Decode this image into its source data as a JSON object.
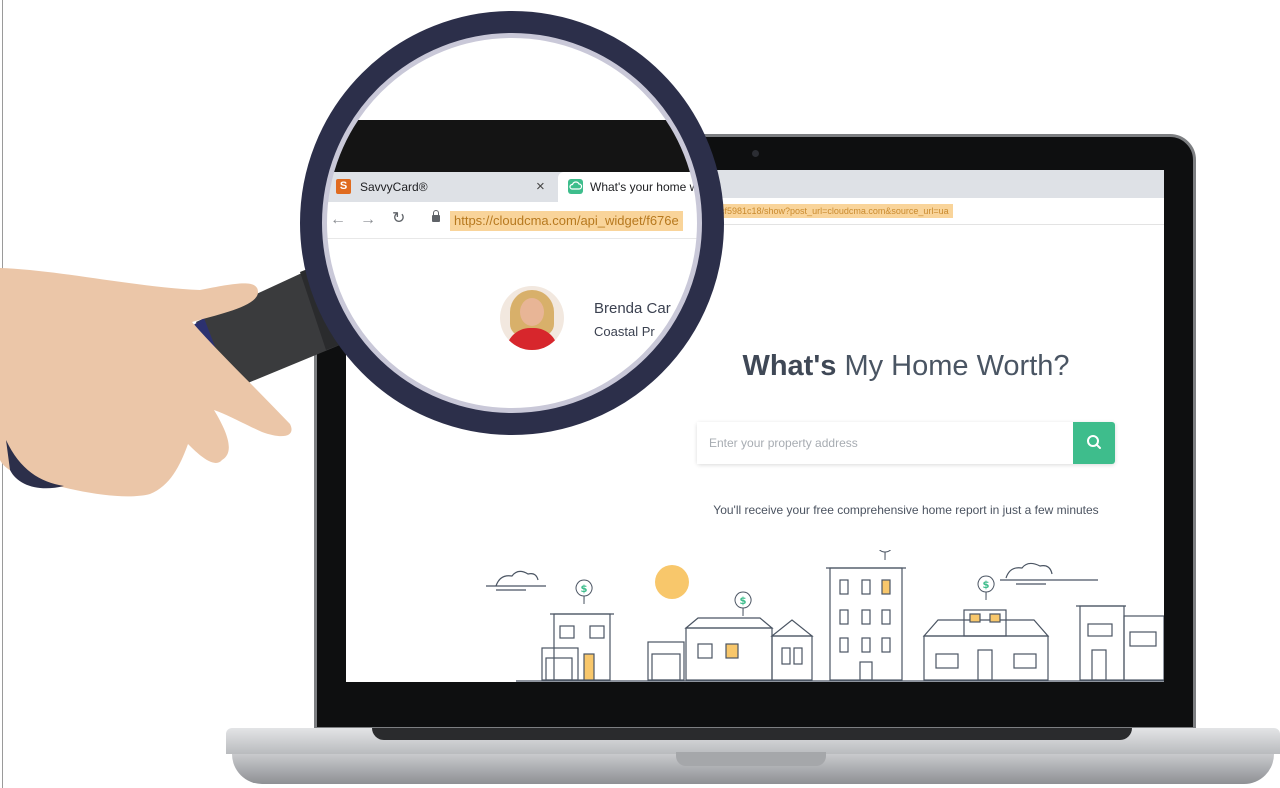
{
  "browser": {
    "tabs": [
      {
        "title": "SavvyCard®",
        "favicon_letter": "S",
        "favicon_color": "#e06b1f"
      },
      {
        "title": "What's your home w",
        "favicon_color": "#3ebd8c"
      }
    ],
    "url_prefix": "https://cloudcma.com/api_widget/f676e",
    "url_suffix": "cf5981c18/show?post_url=cloudcma.com&source_url=ua"
  },
  "agent": {
    "name": "Brenda Car",
    "company": "Coastal Pr"
  },
  "page": {
    "headline_prefix": "What's",
    "headline_suffix": "My Home Worth?",
    "search_placeholder": "Enter your property address",
    "tagline_prefix": "You'll receive your free comprehensive",
    "tagline_suffix": "home report in just a few minutes"
  },
  "colors": {
    "accent": "#3ebd8c",
    "url_highlight": "#f9d49a",
    "magnifier_ring": "#2c2f4a",
    "sun": "#f8c76b"
  },
  "icons": {
    "search": "search-icon",
    "marker": "dollar-location-marker-icon",
    "lock": "lock-icon"
  }
}
